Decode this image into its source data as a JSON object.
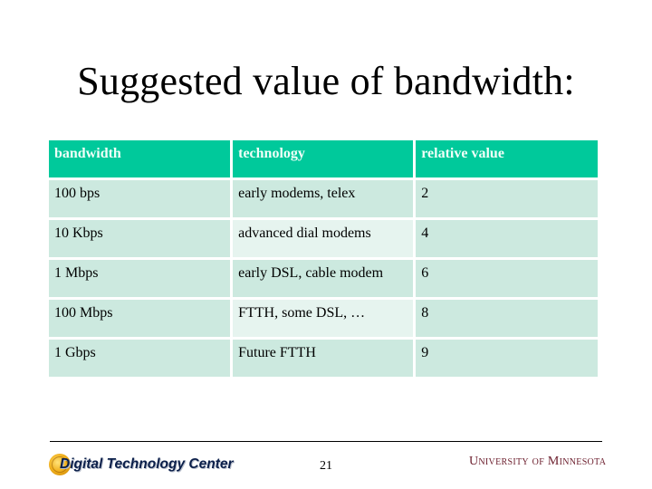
{
  "slide": {
    "title": "Suggested value of bandwidth:",
    "page_number": "21"
  },
  "table": {
    "headers": [
      "bandwidth",
      "technology",
      "relative value"
    ],
    "rows": [
      [
        "100 bps",
        "early modems, telex",
        "2"
      ],
      [
        "10 Kbps",
        "advanced dial modems",
        "4"
      ],
      [
        "1 Mbps",
        "early DSL, cable modem",
        "6"
      ],
      [
        "100 Mbps",
        "FTTH, some DSL, …",
        "8"
      ],
      [
        "1 Gbps",
        "Future FTTH",
        "9"
      ]
    ]
  },
  "footer": {
    "left_logo_text": "Digital Technology Center",
    "right_logo_text": "University of Minnesota"
  },
  "colors": {
    "header_bg": "#00C99B",
    "row_bg": "#CCE9DF",
    "row_alt_bg": "#E6F4EF",
    "umn_maroon": "#6b1d2c"
  }
}
